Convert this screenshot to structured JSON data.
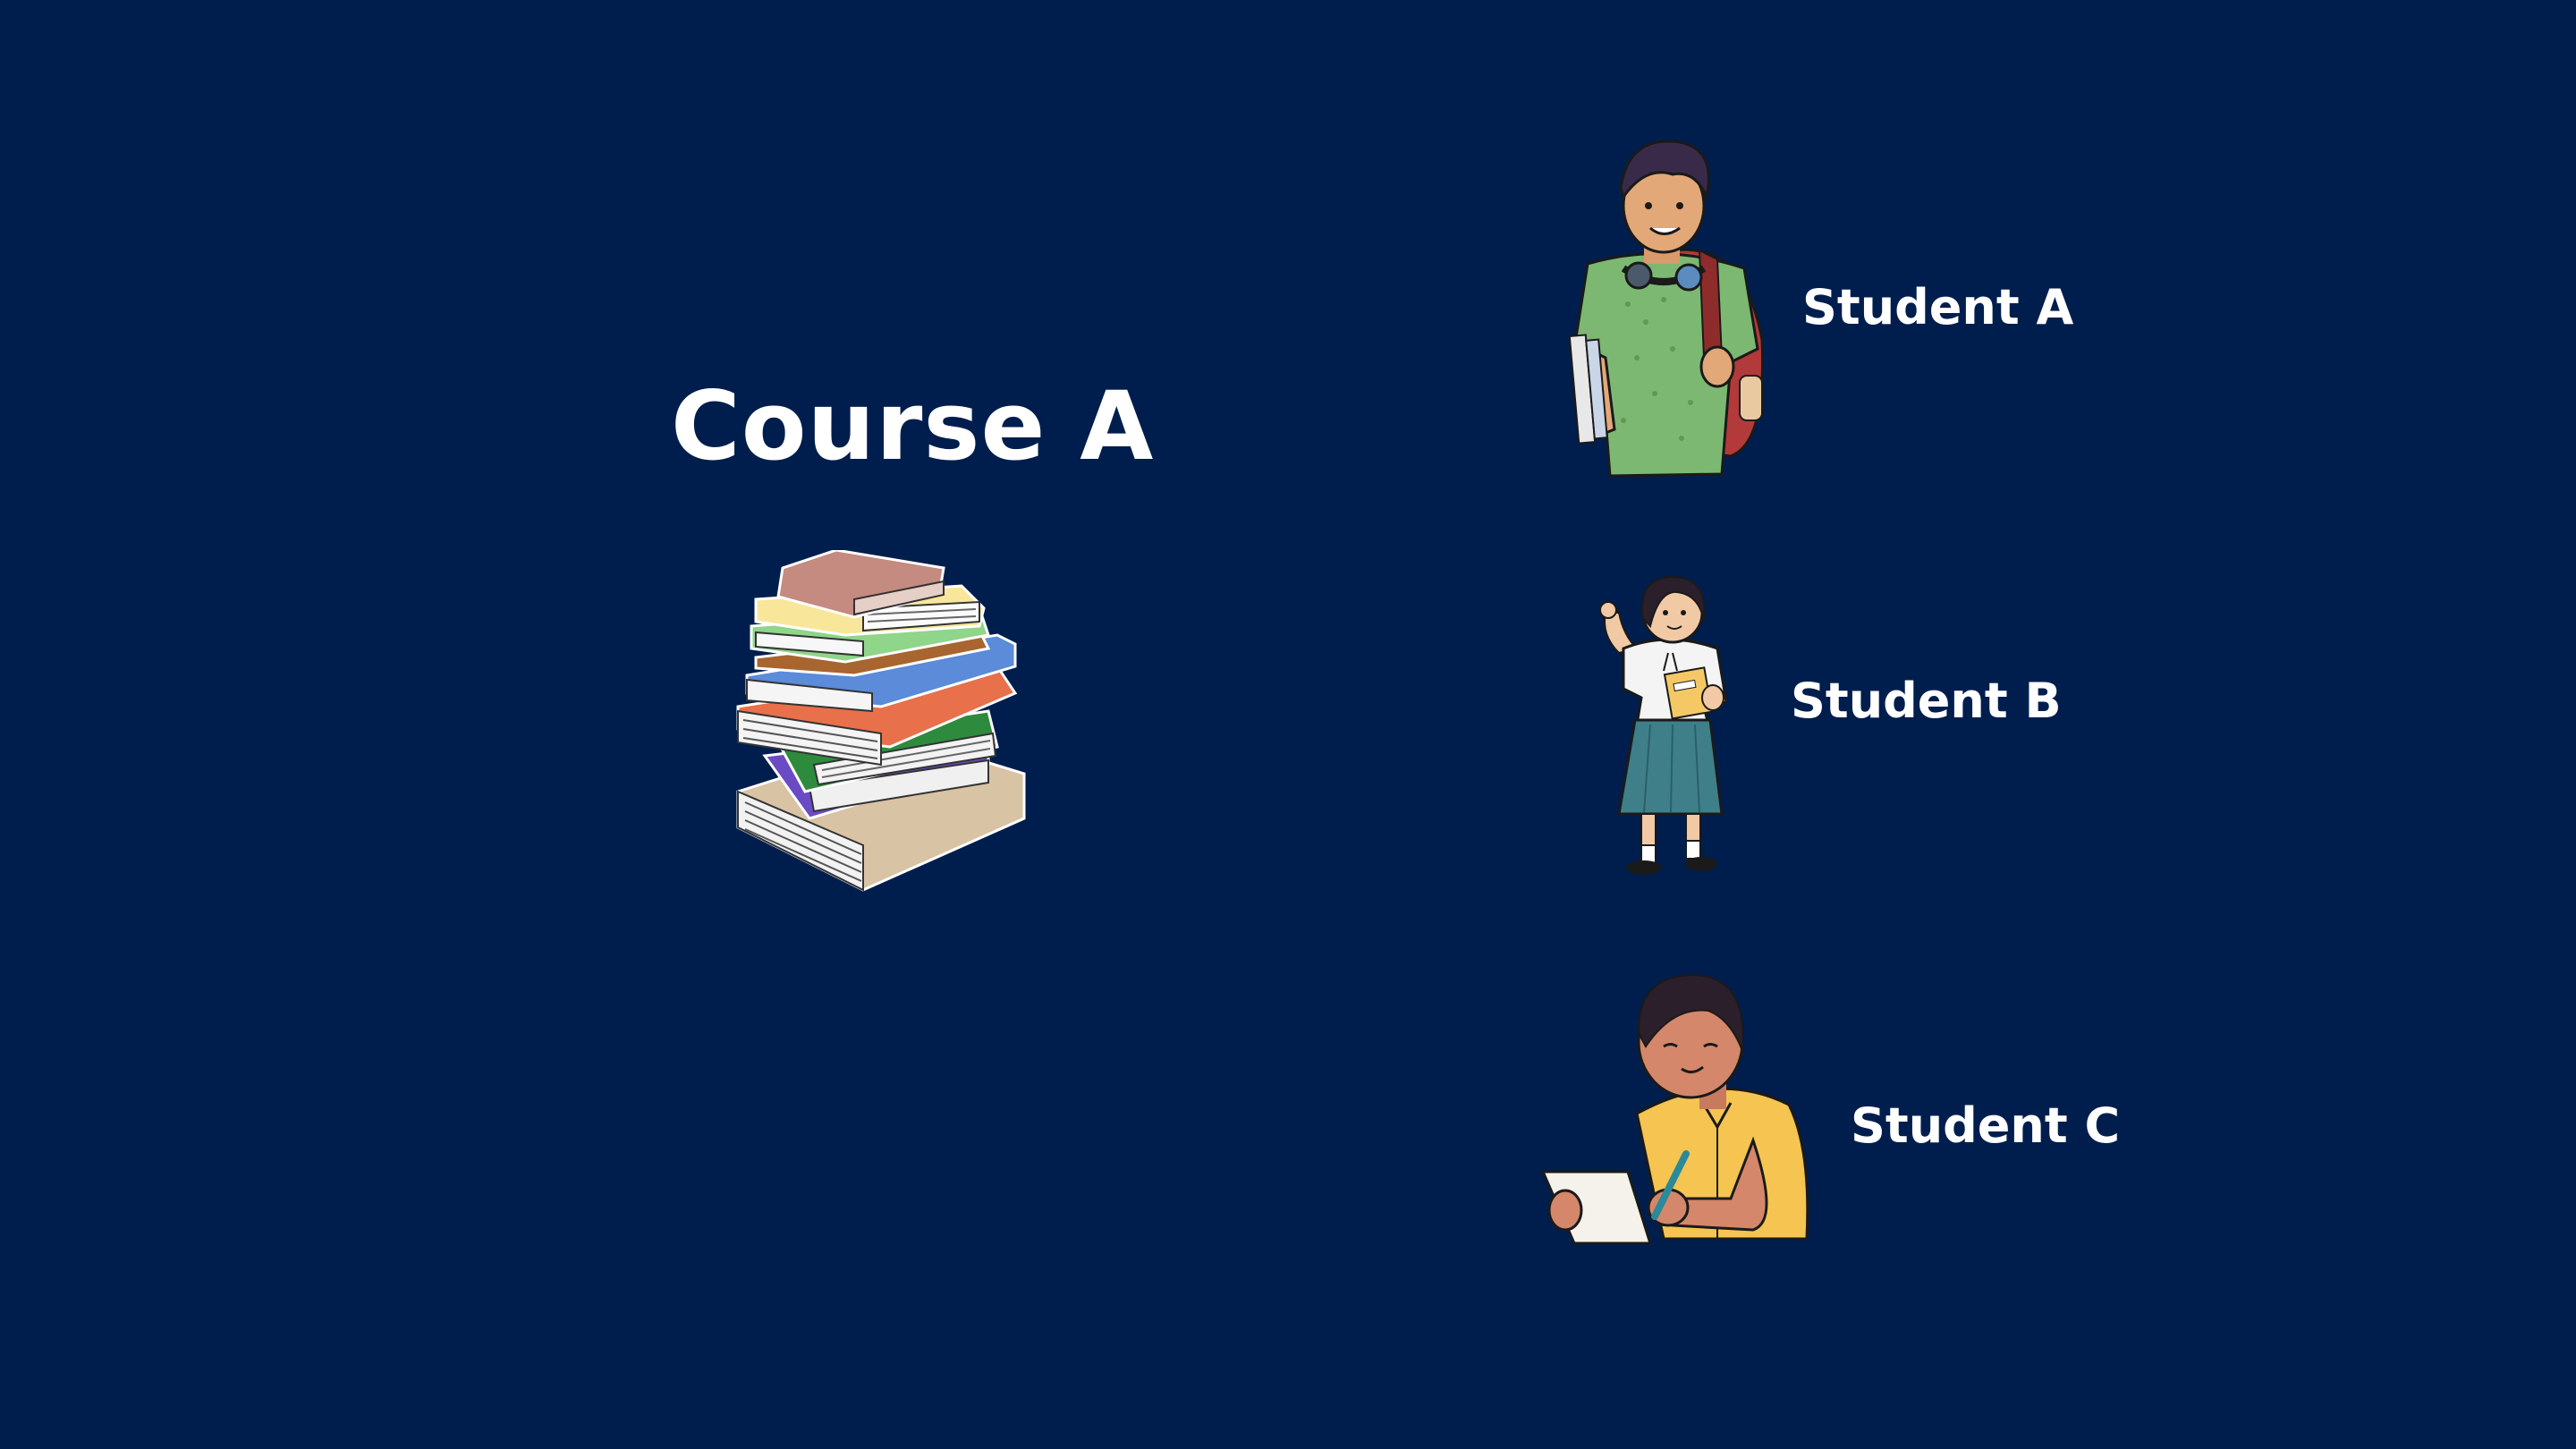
{
  "course": {
    "title": "Course A",
    "image": "book-stack-icon"
  },
  "students": [
    {
      "label": "Student A",
      "image": "student-boy-backpack-icon"
    },
    {
      "label": "Student B",
      "image": "student-girl-icon"
    },
    {
      "label": "Student C",
      "image": "student-writing-icon"
    }
  ],
  "colors": {
    "background": "#001e4d",
    "text": "#ffffff"
  }
}
